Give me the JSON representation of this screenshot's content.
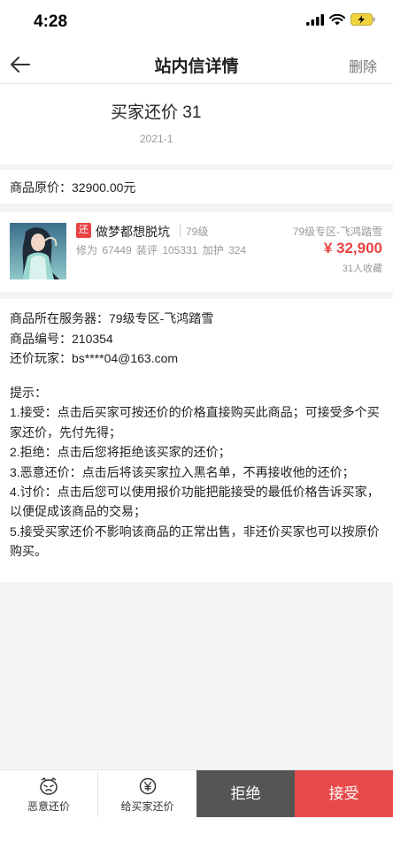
{
  "status_bar": {
    "time": "4:28"
  },
  "nav": {
    "title": "站内信详情",
    "delete_label": "删除"
  },
  "message": {
    "title": "买家还价 31",
    "date": "2021-1"
  },
  "price": {
    "original_label": "商品原价：32900.00元"
  },
  "product": {
    "tag": "还",
    "name": "做梦都想脱坑",
    "level": "79级",
    "server": "79级专区-飞鸿踏雪",
    "stats": "修为 67449  装评 105331  加护 324",
    "price": "¥ 32,900",
    "favorites": "31人收藏"
  },
  "details": {
    "server_line": "商品所在服务器：79级专区-飞鸿踏雪",
    "id_line": "商品编号：210354",
    "player_line": "还价玩家：bs****04@163.com"
  },
  "tips": {
    "heading": "提示：",
    "items": [
      "1.接受：点击后买家可按还价的价格直接购买此商品；可接受多个买家还价，先付先得；",
      "2.拒绝：点击后您将拒绝该买家的还价；",
      "3.恶意还价：点击后将该买家拉入黑名单，不再接收他的还价；",
      "4.讨价：点击后您可以使用报价功能把能接受的最低价格告诉买家，以便促成该商品的交易；",
      "5.接受买家还价不影响该商品的正常出售，非还价买家也可以按原价购买。"
    ]
  },
  "bottom_bar": {
    "malicious_label": "恶意还价",
    "counter_label": "给买家还价",
    "reject_label": "拒绝",
    "accept_label": "接受"
  },
  "colors": {
    "accent": "#e84242",
    "reject_bg": "#555555",
    "accept_bg": "#e84a4a"
  },
  "icons": [
    "back-arrow-icon",
    "signal-icon",
    "wifi-icon",
    "battery-icon",
    "angry-face-icon",
    "yen-coin-icon"
  ]
}
